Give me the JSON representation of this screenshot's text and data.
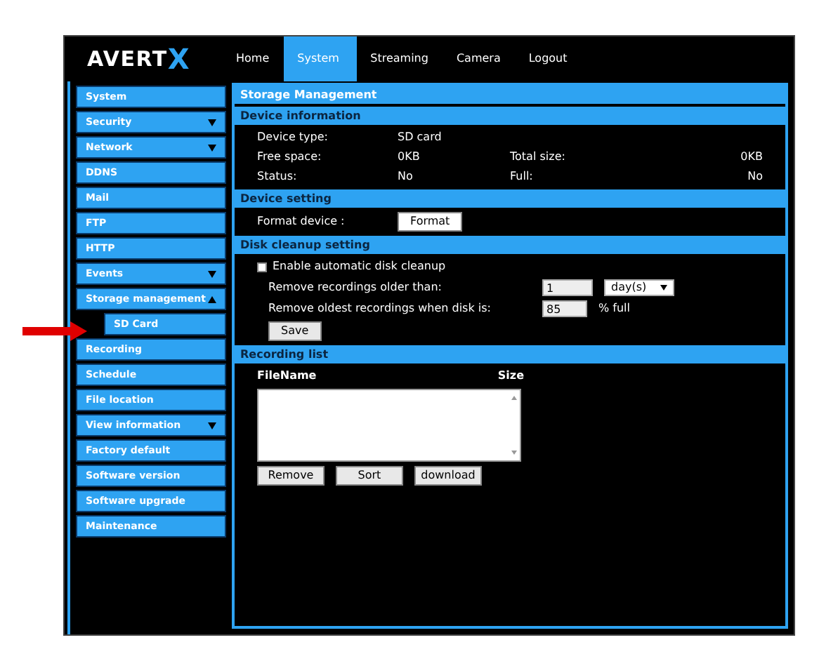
{
  "logo": {
    "wordmark": "AVERT",
    "mark": "X"
  },
  "nav": [
    {
      "label": "Home",
      "selected": false
    },
    {
      "label": "System",
      "selected": true
    },
    {
      "label": "Streaming",
      "selected": false
    },
    {
      "label": "Camera",
      "selected": false
    },
    {
      "label": "Logout",
      "selected": false
    }
  ],
  "sidebar": {
    "items": [
      {
        "label": "System",
        "kind": "link"
      },
      {
        "label": "Security",
        "kind": "group",
        "expanded": false
      },
      {
        "label": "Network",
        "kind": "group",
        "expanded": false
      },
      {
        "label": "DDNS",
        "kind": "link"
      },
      {
        "label": "Mail",
        "kind": "link"
      },
      {
        "label": "FTP",
        "kind": "link"
      },
      {
        "label": "HTTP",
        "kind": "link"
      },
      {
        "label": "Events",
        "kind": "group",
        "expanded": false
      },
      {
        "label": "Storage management",
        "kind": "group",
        "expanded": true,
        "children": [
          {
            "label": "SD Card"
          }
        ]
      },
      {
        "label": "Recording",
        "kind": "link"
      },
      {
        "label": "Schedule",
        "kind": "link"
      },
      {
        "label": "File location",
        "kind": "link"
      },
      {
        "label": "View information",
        "kind": "group",
        "expanded": false
      },
      {
        "label": "Factory default",
        "kind": "link"
      },
      {
        "label": "Software version",
        "kind": "link"
      },
      {
        "label": "Software upgrade",
        "kind": "link"
      },
      {
        "label": "Maintenance",
        "kind": "link"
      }
    ]
  },
  "page_title": "Storage Management",
  "device_information": {
    "title": "Device information",
    "rows": [
      [
        {
          "label": "Device type:",
          "value": "SD card"
        }
      ],
      [
        {
          "label": "Free space:",
          "value": "0KB"
        },
        {
          "label": "Total size:",
          "value": "0KB"
        }
      ],
      [
        {
          "label": "Status:",
          "value": "No"
        },
        {
          "label": "Full:",
          "value": "No"
        }
      ]
    ]
  },
  "device_setting": {
    "title": "Device setting",
    "label": "Format device :",
    "button": "Format"
  },
  "disk_cleanup": {
    "title": "Disk cleanup setting",
    "enable": {
      "label": "Enable automatic disk cleanup",
      "checked": false
    },
    "older_than": {
      "label": "Remove recordings older than:",
      "value": "1",
      "unit": "day(s)"
    },
    "when_full": {
      "label": "Remove oldest recordings when disk is:",
      "value": "85",
      "suffix": "% full"
    },
    "button": "Save"
  },
  "recording_list": {
    "title": "Recording list",
    "columns": [
      "FileName",
      "Size"
    ],
    "buttons": [
      "Remove",
      "Sort",
      "download"
    ]
  }
}
